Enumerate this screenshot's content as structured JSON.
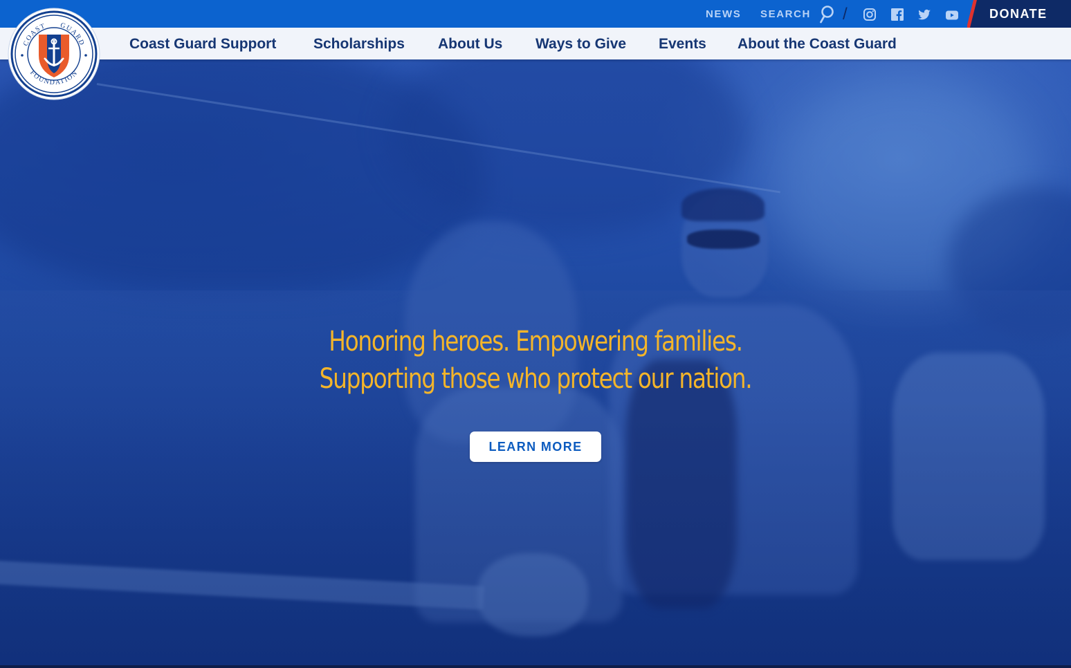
{
  "colors": {
    "utility_bar": "#0c63cf",
    "utility_link": "#b9d3f6",
    "donate_bg": "#0e2a66",
    "donate_stripe": "#e0322d",
    "nav_bg": "#f1f4fa",
    "nav_text": "#163673",
    "headline": "#f4b52a",
    "button_text": "#0c5bbf",
    "logo_orange": "#e95b2b",
    "logo_navy": "#13408f"
  },
  "utility": {
    "news_label": "NEWS",
    "search_label": "SEARCH",
    "search_icon": "search-icon",
    "social": [
      "instagram-icon",
      "facebook-icon",
      "twitter-icon",
      "youtube-icon"
    ],
    "donate_label": "DONATE"
  },
  "logo": {
    "ring_top_text": "COAST GUARD",
    "ring_bottom_text": "FOUNDATION"
  },
  "nav": {
    "items": [
      {
        "label": "Coast Guard Support"
      },
      {
        "label": "Scholarships"
      },
      {
        "label": "About Us"
      },
      {
        "label": "Ways to Give"
      },
      {
        "label": "Events"
      },
      {
        "label": "About the Coast Guard"
      }
    ]
  },
  "hero": {
    "headline_line1": "Honoring heroes. Empowering families.",
    "headline_line2": "Supporting those who protect our nation.",
    "cta_label": "LEARN MORE"
  }
}
